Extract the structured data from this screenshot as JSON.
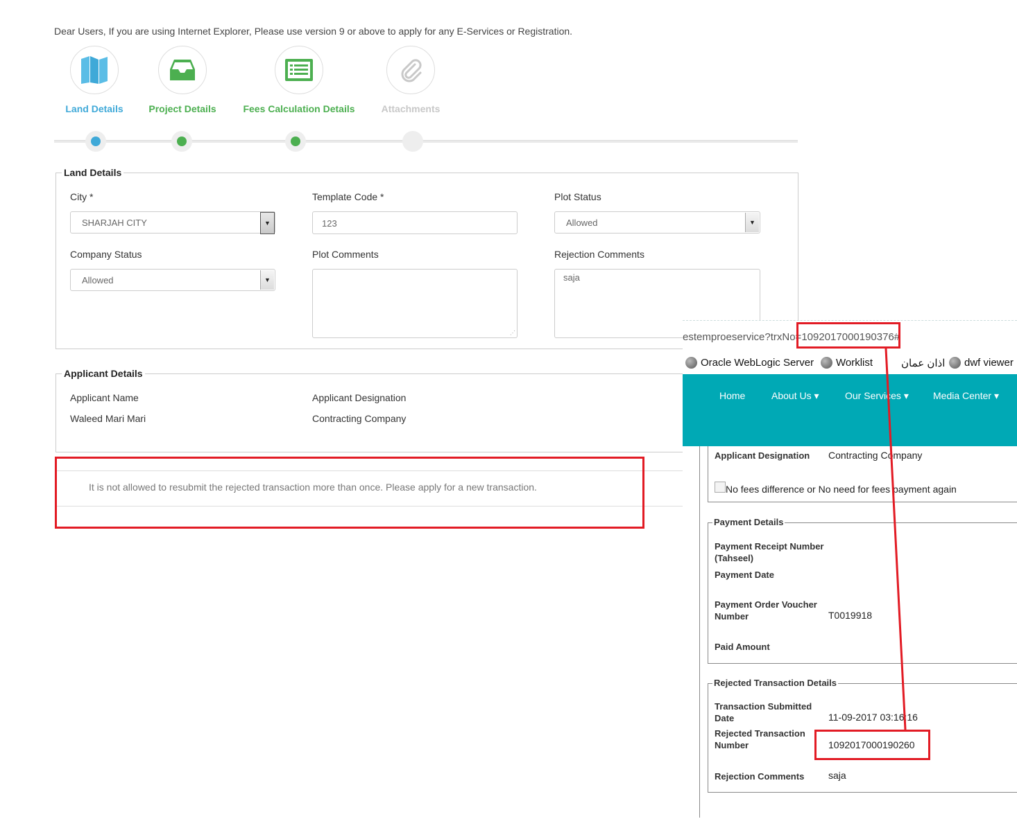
{
  "notice": "Dear Users, If you are using Internet Explorer, Please use version 9 or above to apply for any E-Services or Registration.",
  "wizard": {
    "steps": [
      {
        "label": "Land Details",
        "icon": "map-icon",
        "color": "#3fa9d8",
        "state": "current"
      },
      {
        "label": "Project Details",
        "icon": "inbox-icon",
        "color": "#4caf50",
        "state": "done"
      },
      {
        "label": "Fees Calculation Details",
        "icon": "list-icon",
        "color": "#4caf50",
        "state": "done"
      },
      {
        "label": "Attachments",
        "icon": "paperclip-icon",
        "color": "#c8c8c8",
        "state": "pending"
      }
    ]
  },
  "land_details": {
    "legend": "Land Details",
    "city_label": "City *",
    "city_value": "SHARJAH CITY",
    "template_code_label": "Template Code *",
    "template_code_value": "123",
    "plot_status_label": "Plot Status",
    "plot_status_value": "Allowed",
    "company_status_label": "Company Status",
    "company_status_value": "Allowed",
    "plot_comments_label": "Plot Comments",
    "plot_comments_value": "",
    "rejection_comments_label": "Rejection Comments",
    "rejection_comments_value": "saja"
  },
  "applicant_details": {
    "legend": "Applicant Details",
    "name_label": "Applicant Name",
    "name_value": "Waleed Mari Mari",
    "designation_label": "Applicant Designation",
    "designation_value": "Contracting Company"
  },
  "message": "It is not allowed to resubmit the rejected transaction more than once. Please apply for a new transaction.",
  "overlay": {
    "url_prefix": "estemproeservice?trxNo=",
    "url_trx": "1092017000190376#",
    "bookmarks": [
      "Oracle WebLogic Server",
      "Worklist",
      "اذان عمان",
      "dwf viewer"
    ],
    "nav": [
      "Home",
      "About Us",
      "Our Services",
      "Media Center"
    ],
    "applicant_designation_label": "Applicant Designation",
    "applicant_designation_value": "Contracting Company",
    "no_fees_label": "No fees difference or No need for fees payment again",
    "payment_legend": "Payment Details",
    "receipt_label_1": "Payment Receipt Number",
    "receipt_label_2": "(Tahseel)",
    "payment_date_label": "Payment Date",
    "voucher_label_1": "Payment Order Voucher",
    "voucher_label_2": "Number",
    "voucher_value": "T0019918",
    "paid_amount_label": "Paid Amount",
    "rejected_legend": "Rejected Transaction Details",
    "submitted_label_1": "Transaction Submitted",
    "submitted_label_2": "Date",
    "submitted_value": "11-09-2017 03:16:16",
    "rejected_label_1": "Rejected Transaction",
    "rejected_label_2": "Number",
    "rejected_value": "1092017000190260",
    "rej_comments_label": "Rejection Comments",
    "rej_comments_value": "saja"
  },
  "colors": {
    "accent_blue": "#3fa9d8",
    "accent_green": "#4caf50",
    "highlight_red": "#e21b24",
    "navbar_teal": "#00a9b5"
  }
}
